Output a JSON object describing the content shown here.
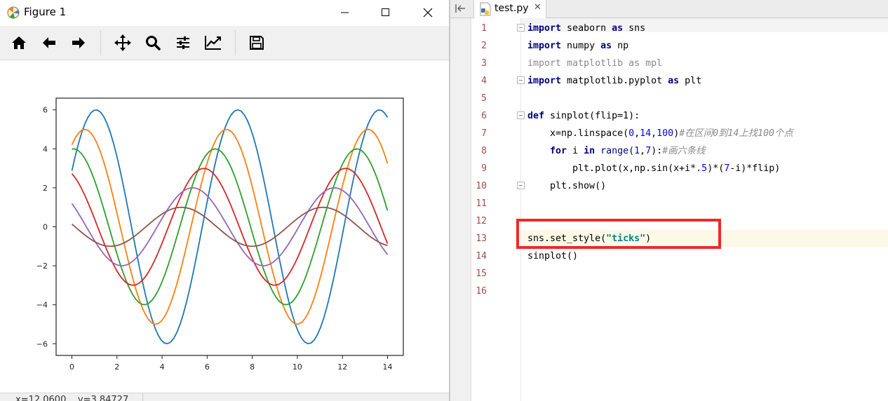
{
  "figure_window": {
    "title": "Figure 1",
    "toolbar": {
      "home": "home-icon",
      "back": "back-arrow-icon",
      "forward": "forward-arrow-icon",
      "pan": "move-icon",
      "zoom": "zoom-icon",
      "configure": "sliders-icon",
      "edit_axis": "line-chart-icon",
      "save": "save-icon"
    },
    "status_text": "x=12.0600    y=3.84727"
  },
  "chart_data": {
    "type": "line",
    "title": "",
    "xlabel": "",
    "ylabel": "",
    "xlim": [
      -0.7,
      14.7
    ],
    "ylim": [
      -6.6,
      6.6
    ],
    "xticks": [
      "0",
      "2",
      "4",
      "6",
      "8",
      "10",
      "12",
      "14"
    ],
    "yticks": [
      "−6",
      "−4",
      "−2",
      "0",
      "2",
      "4",
      "6"
    ],
    "x_range": [
      0,
      14
    ],
    "points": 100,
    "formula": "sin(x + i*0.5) * (7 - i)",
    "series": [
      {
        "i": 1,
        "amplitude": 6,
        "phase": 0.5,
        "color": "#1f77b4"
      },
      {
        "i": 2,
        "amplitude": 5,
        "phase": 1.0,
        "color": "#ff7f0e"
      },
      {
        "i": 3,
        "amplitude": 4,
        "phase": 1.5,
        "color": "#2ca02c"
      },
      {
        "i": 4,
        "amplitude": 3,
        "phase": 2.0,
        "color": "#d62728"
      },
      {
        "i": 5,
        "amplitude": 2,
        "phase": 2.5,
        "color": "#9467bd"
      },
      {
        "i": 6,
        "amplitude": 1,
        "phase": 3.0,
        "color": "#8c564b"
      }
    ]
  },
  "editor": {
    "tab_label": "test.py",
    "tab_close": "✕",
    "line_numbers": [
      "1",
      "2",
      "3",
      "4",
      "5",
      "6",
      "7",
      "8",
      "9",
      "10",
      "11",
      "12",
      "13",
      "14",
      "15",
      "16"
    ],
    "code": {
      "l1_kw1": "import",
      "l1_t1": " seaborn ",
      "l1_kw2": "as",
      "l1_t2": " sns",
      "l2_kw1": "import",
      "l2_t1": " numpy ",
      "l2_kw2": "as",
      "l2_t2": " np",
      "l3": "import matplotlib as mpl",
      "l4_kw1": "import",
      "l4_t1": " matplotlib.pyplot ",
      "l4_kw2": "as",
      "l4_t2": " plt",
      "l6_kw": "def",
      "l6_t": " sinplot(flip=1):",
      "l7_t1": "    x=np.linspace(",
      "l7_n1": "0",
      "l7_c1": ",",
      "l7_n2": "14",
      "l7_c2": ",",
      "l7_n3": "100",
      "l7_t2": ")",
      "l7_cmt": "#在区间0到14上找100个点",
      "l8_kw1": "    for",
      "l8_t1": " i ",
      "l8_kw2": "in",
      "l8_t2": " ",
      "l8_bi": "range",
      "l8_t3": "(",
      "l8_n1": "1",
      "l8_t4": ",",
      "l8_n2": "7",
      "l8_t5": "):",
      "l8_cmt": "#画六条线",
      "l9_t1": "        plt.plot(x,np.sin(x+i*",
      "l9_n1": ".5",
      "l9_t2": ")*(",
      "l9_n2": "7",
      "l9_t3": "-i)*flip)",
      "l10": "    plt.show()",
      "l13_t1": "sns.set_style(",
      "l13_str": "\"ticks\"",
      "l13_t2": ")",
      "l14": "sinplot()"
    }
  }
}
